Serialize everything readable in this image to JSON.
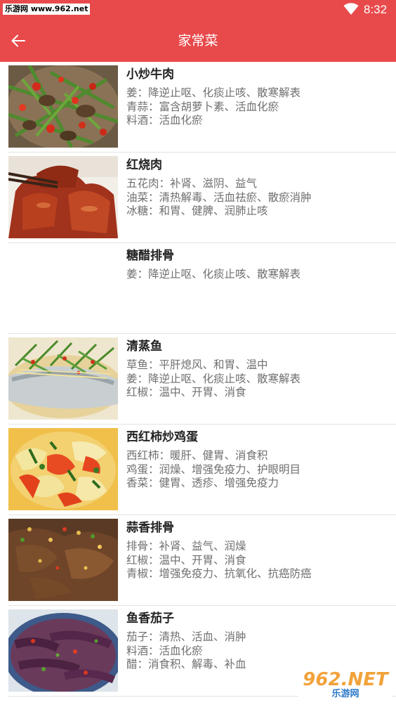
{
  "status_bar": {
    "watermark": "乐游网 www.962.net",
    "time": "8:32",
    "wifi_icon": "wifi-icon"
  },
  "header": {
    "title": "家常菜",
    "back_icon": "arrow-left-icon",
    "background": "#e84a4c"
  },
  "dishes": [
    {
      "name": "小炒牛肉",
      "effects": [
        "姜：降逆止呕、化痰止咳、散寒解表",
        "青蒜：富含胡萝卜素、活血化瘀",
        "料酒：活血化瘀"
      ],
      "image": "stir-fried-beef-photo"
    },
    {
      "name": "红烧肉",
      "effects": [
        "五花肉：补肾、滋阴、益气",
        "油菜：清热解毒、活血祛瘀、散瘀消肿",
        "冰糖：和胃、健脾、润肺止咳"
      ],
      "image": "braised-pork-photo"
    },
    {
      "name": "糖醋排骨",
      "effects": [
        "姜：降逆止呕、化痰止咳、散寒解表"
      ],
      "image": ""
    },
    {
      "name": "清蒸鱼",
      "effects": [
        "草鱼：平肝熄风、和胃、温中",
        "姜：降逆止呕、化痰止咳、散寒解表",
        "红椒：温中、开胃、消食"
      ],
      "image": "steamed-fish-photo"
    },
    {
      "name": "西红柿炒鸡蛋",
      "effects": [
        "西红柿：暖肝、健胃、消食积",
        "鸡蛋：润燥、增强免疫力、护眼明目",
        "香菜：健胃、透疹、增强免疫力"
      ],
      "image": "tomato-egg-photo"
    },
    {
      "name": "蒜香排骨",
      "effects": [
        "排骨：补肾、益气、润燥",
        "红椒：温中、开胃、消食",
        "青椒：增强免疫力、抗氧化、抗癌防癌"
      ],
      "image": "garlic-ribs-photo"
    },
    {
      "name": "鱼香茄子",
      "effects": [
        "茄子：清热、活血、消肿",
        "料酒：活血化瘀",
        "醋：消食积、解毒、补血"
      ],
      "image": "eggplant-photo"
    }
  ],
  "watermark_bottom": {
    "number": "962.NET",
    "name": "乐游网"
  }
}
